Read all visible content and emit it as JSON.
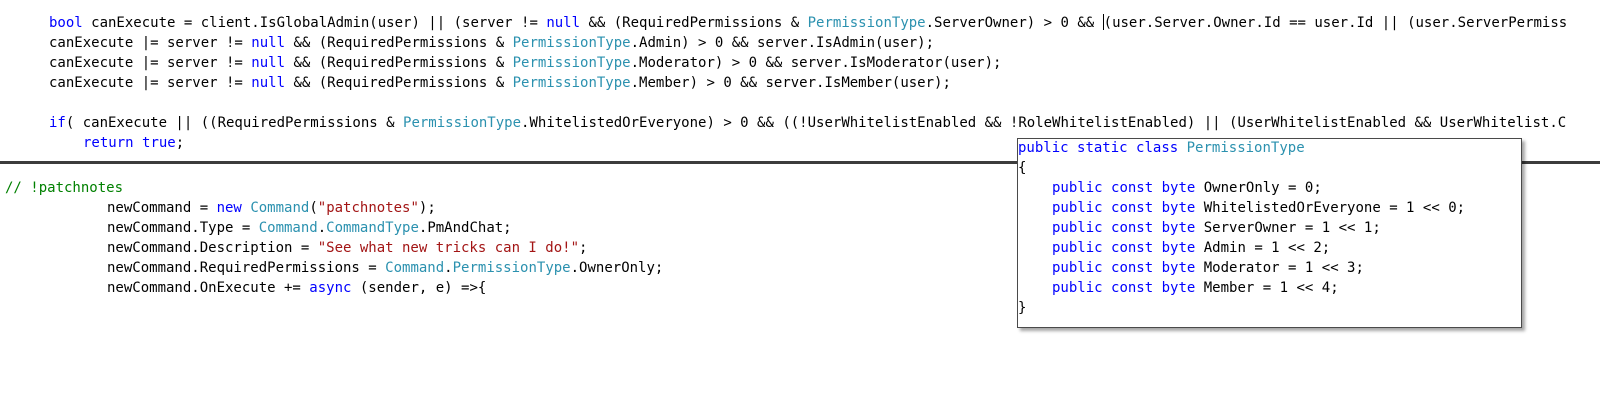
{
  "colors": {
    "keyword": "#0000ff",
    "type": "#2b91af",
    "string": "#a31515",
    "comment": "#008000",
    "text": "#000000",
    "background": "#ffffff",
    "divider": "#3c3c3c"
  },
  "top_pane": {
    "lines": [
      {
        "indent": 1,
        "tokens": [
          {
            "t": "kw",
            "s": "bool"
          },
          {
            "t": "plain",
            "s": " canExecute = client.IsGlobalAdmin(user) || (server != "
          },
          {
            "t": "kw",
            "s": "null"
          },
          {
            "t": "plain",
            "s": " && (RequiredPermissions & "
          },
          {
            "t": "type",
            "s": "PermissionType"
          },
          {
            "t": "plain",
            "s": ".ServerOwner) > 0 && "
          },
          {
            "t": "caret",
            "s": ""
          },
          {
            "t": "plain",
            "s": "(user.Server.Owner.Id == user.Id || (user.ServerPermiss"
          }
        ]
      },
      {
        "indent": 1,
        "tokens": [
          {
            "t": "plain",
            "s": "canExecute |= server != "
          },
          {
            "t": "kw",
            "s": "null"
          },
          {
            "t": "plain",
            "s": " && (RequiredPermissions & "
          },
          {
            "t": "type",
            "s": "PermissionType"
          },
          {
            "t": "plain",
            "s": ".Admin) > 0 && server.IsAdmin(user);"
          }
        ]
      },
      {
        "indent": 1,
        "tokens": [
          {
            "t": "plain",
            "s": "canExecute |= server != "
          },
          {
            "t": "kw",
            "s": "null"
          },
          {
            "t": "plain",
            "s": " && (RequiredPermissions & "
          },
          {
            "t": "type",
            "s": "PermissionType"
          },
          {
            "t": "plain",
            "s": ".Moderator) > 0 && server.IsModerator(user);"
          }
        ]
      },
      {
        "indent": 1,
        "tokens": [
          {
            "t": "plain",
            "s": "canExecute |= server != "
          },
          {
            "t": "kw",
            "s": "null"
          },
          {
            "t": "plain",
            "s": " && (RequiredPermissions & "
          },
          {
            "t": "type",
            "s": "PermissionType"
          },
          {
            "t": "plain",
            "s": ".Member) > 0 && server.IsMember(user);"
          }
        ]
      },
      {
        "indent": 1,
        "tokens": []
      },
      {
        "indent": 1,
        "tokens": [
          {
            "t": "kw",
            "s": "if"
          },
          {
            "t": "plain",
            "s": "( canExecute || ((RequiredPermissions & "
          },
          {
            "t": "type",
            "s": "PermissionType"
          },
          {
            "t": "plain",
            "s": ".WhitelistedOrEveryone) > 0 && ((!UserWhitelistEnabled && !RoleWhitelistEnabled) || (UserWhitelistEnabled && UserWhitelist.C"
          }
        ]
      },
      {
        "indent": 2,
        "tokens": [
          {
            "t": "kw",
            "s": "return"
          },
          {
            "t": "plain",
            "s": " "
          },
          {
            "t": "kw",
            "s": "true"
          },
          {
            "t": "plain",
            "s": ";"
          }
        ]
      }
    ]
  },
  "bottom_pane": {
    "lines": [
      {
        "indent": 0,
        "tokens": []
      },
      {
        "indent": 0,
        "tokens": [
          {
            "t": "comment",
            "s": "// !patchnotes"
          }
        ]
      },
      {
        "indent": 3,
        "tokens": [
          {
            "t": "plain",
            "s": "newCommand = "
          },
          {
            "t": "kw",
            "s": "new"
          },
          {
            "t": "plain",
            "s": " "
          },
          {
            "t": "type",
            "s": "Command"
          },
          {
            "t": "plain",
            "s": "("
          },
          {
            "t": "str",
            "s": "\"patchnotes\""
          },
          {
            "t": "plain",
            "s": ");"
          }
        ]
      },
      {
        "indent": 3,
        "tokens": [
          {
            "t": "plain",
            "s": "newCommand.Type = "
          },
          {
            "t": "type",
            "s": "Command"
          },
          {
            "t": "plain",
            "s": "."
          },
          {
            "t": "type",
            "s": "CommandType"
          },
          {
            "t": "plain",
            "s": ".PmAndChat;"
          }
        ]
      },
      {
        "indent": 3,
        "tokens": [
          {
            "t": "plain",
            "s": "newCommand.Description = "
          },
          {
            "t": "str",
            "s": "\"See what new tricks can I do!\""
          },
          {
            "t": "plain",
            "s": ";"
          }
        ]
      },
      {
        "indent": 3,
        "tokens": [
          {
            "t": "plain",
            "s": "newCommand.RequiredPermissions = "
          },
          {
            "t": "type",
            "s": "Command"
          },
          {
            "t": "plain",
            "s": "."
          },
          {
            "t": "type",
            "s": "PermissionType"
          },
          {
            "t": "plain",
            "s": ".OwnerOnly;"
          }
        ]
      },
      {
        "indent": 3,
        "tokens": [
          {
            "t": "plain",
            "s": "newCommand.OnExecute += "
          },
          {
            "t": "kw",
            "s": "async"
          },
          {
            "t": "plain",
            "s": " (sender, e) =>{"
          }
        ]
      }
    ]
  },
  "peek_popup": {
    "lines": [
      {
        "indent": 0,
        "tokens": [
          {
            "t": "kw",
            "s": "public"
          },
          {
            "t": "plain",
            "s": " "
          },
          {
            "t": "kw",
            "s": "static"
          },
          {
            "t": "plain",
            "s": " "
          },
          {
            "t": "kw",
            "s": "class"
          },
          {
            "t": "plain",
            "s": " "
          },
          {
            "t": "type",
            "s": "PermissionType"
          }
        ]
      },
      {
        "indent": 0,
        "tokens": [
          {
            "t": "plain",
            "s": "{"
          }
        ]
      },
      {
        "indent": 1,
        "tokens": [
          {
            "t": "kw",
            "s": "public"
          },
          {
            "t": "plain",
            "s": " "
          },
          {
            "t": "kw",
            "s": "const"
          },
          {
            "t": "plain",
            "s": " "
          },
          {
            "t": "kw",
            "s": "byte"
          },
          {
            "t": "plain",
            "s": " OwnerOnly = 0;"
          }
        ]
      },
      {
        "indent": 1,
        "tokens": [
          {
            "t": "kw",
            "s": "public"
          },
          {
            "t": "plain",
            "s": " "
          },
          {
            "t": "kw",
            "s": "const"
          },
          {
            "t": "plain",
            "s": " "
          },
          {
            "t": "kw",
            "s": "byte"
          },
          {
            "t": "plain",
            "s": " WhitelistedOrEveryone = 1 << 0;"
          }
        ]
      },
      {
        "indent": 1,
        "tokens": [
          {
            "t": "kw",
            "s": "public"
          },
          {
            "t": "plain",
            "s": " "
          },
          {
            "t": "kw",
            "s": "const"
          },
          {
            "t": "plain",
            "s": " "
          },
          {
            "t": "kw",
            "s": "byte"
          },
          {
            "t": "plain",
            "s": " ServerOwner = 1 << 1;"
          }
        ]
      },
      {
        "indent": 1,
        "tokens": [
          {
            "t": "kw",
            "s": "public"
          },
          {
            "t": "plain",
            "s": " "
          },
          {
            "t": "kw",
            "s": "const"
          },
          {
            "t": "plain",
            "s": " "
          },
          {
            "t": "kw",
            "s": "byte"
          },
          {
            "t": "plain",
            "s": " Admin = 1 << 2;"
          }
        ]
      },
      {
        "indent": 1,
        "tokens": [
          {
            "t": "kw",
            "s": "public"
          },
          {
            "t": "plain",
            "s": " "
          },
          {
            "t": "kw",
            "s": "const"
          },
          {
            "t": "plain",
            "s": " "
          },
          {
            "t": "kw",
            "s": "byte"
          },
          {
            "t": "plain",
            "s": " Moderator = 1 << 3;"
          }
        ]
      },
      {
        "indent": 1,
        "tokens": [
          {
            "t": "kw",
            "s": "public"
          },
          {
            "t": "plain",
            "s": " "
          },
          {
            "t": "kw",
            "s": "const"
          },
          {
            "t": "plain",
            "s": " "
          },
          {
            "t": "kw",
            "s": "byte"
          },
          {
            "t": "plain",
            "s": " Member = 1 << 4;"
          }
        ]
      },
      {
        "indent": 0,
        "tokens": [
          {
            "t": "plain",
            "s": "}"
          }
        ]
      }
    ]
  }
}
